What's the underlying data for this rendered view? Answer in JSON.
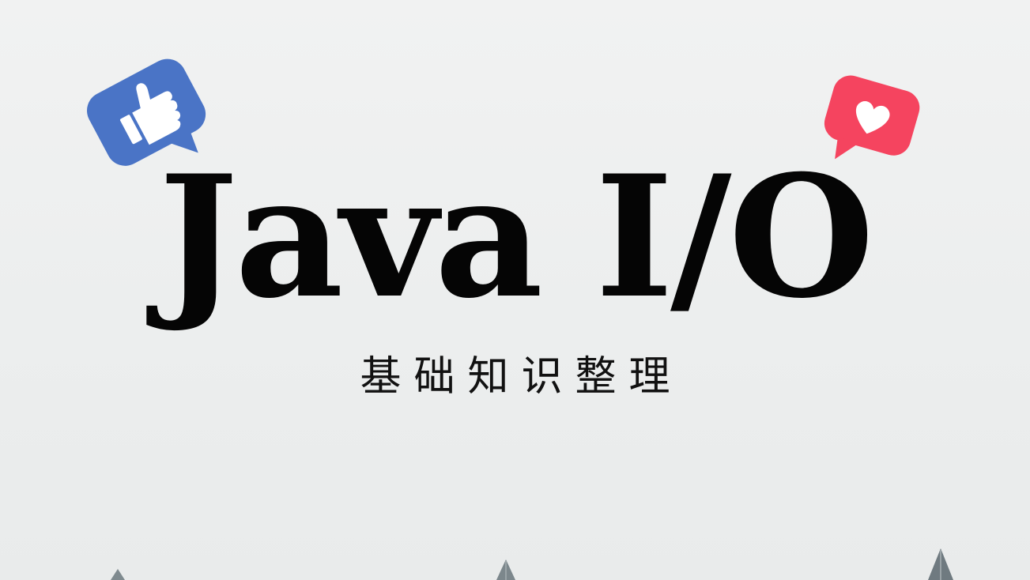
{
  "cover": {
    "title": "Java I/O",
    "subtitle": "基础知识整理"
  },
  "icons": {
    "like": {
      "name": "thumbs-up-icon",
      "color": "#4a74c6"
    },
    "heart": {
      "name": "heart-icon",
      "color": "#f5445f"
    }
  },
  "colors": {
    "background": "#eceeee",
    "text": "#050505"
  }
}
